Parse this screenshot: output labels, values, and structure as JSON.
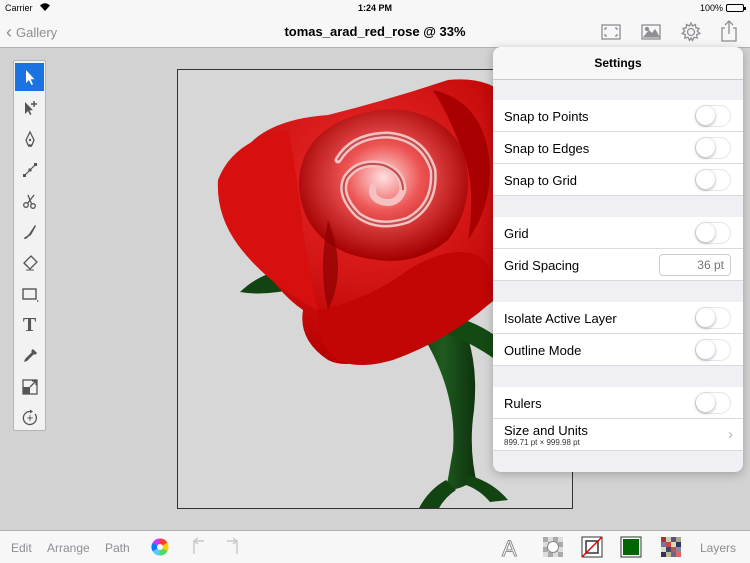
{
  "status_bar": {
    "carrier": "Carrier",
    "time": "1:24 PM",
    "battery": "100%"
  },
  "nav": {
    "back_label": "Gallery",
    "title": "tomas_arad_red_rose @ 33%",
    "icons": [
      "fullscreen-icon",
      "image-icon",
      "gear-icon",
      "share-icon"
    ]
  },
  "toolbox": {
    "tools": [
      "select-arrow-icon",
      "direct-select-icon",
      "pen-icon",
      "node-icon",
      "scissors-icon",
      "brush-icon",
      "eraser-icon",
      "rectangle-icon",
      "text-icon",
      "eyedropper-icon",
      "transform-icon",
      "rotate-icon"
    ],
    "active_tool": "select-arrow-icon",
    "text_tool_glyph": "T"
  },
  "settings": {
    "title": "Settings",
    "snap_points": "Snap to Points",
    "snap_edges": "Snap to Edges",
    "snap_grid": "Snap to Grid",
    "grid": "Grid",
    "grid_spacing": "Grid Spacing",
    "grid_spacing_placeholder": "36 pt",
    "isolate_layer": "Isolate Active Layer",
    "outline_mode": "Outline Mode",
    "rulers": "Rulers",
    "size_units": "Size and Units",
    "size_units_value": "899.71 pt × 999.98 pt"
  },
  "bottom_bar": {
    "edit": "Edit",
    "arrange": "Arrange",
    "path": "Path",
    "layers": "Layers",
    "typography_glyph": "A",
    "fill_color": "#006600",
    "accent": "#1a73e0"
  }
}
